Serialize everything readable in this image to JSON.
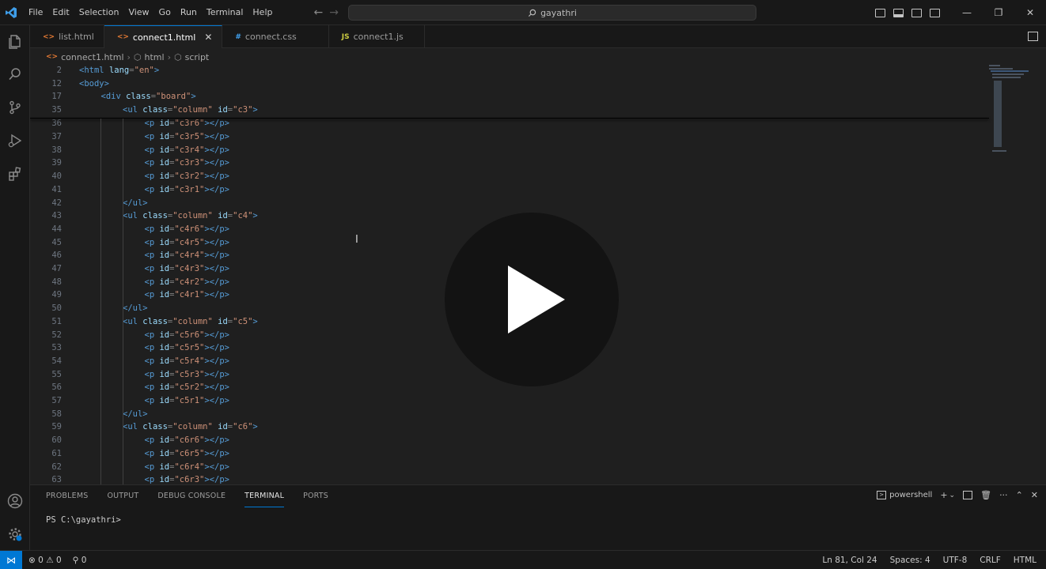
{
  "menu": [
    "File",
    "Edit",
    "Selection",
    "View",
    "Go",
    "Run",
    "Terminal",
    "Help"
  ],
  "command_center": {
    "text": "gayathri"
  },
  "tabs": [
    {
      "label": "list.html",
      "icon": "html-file-icon",
      "icon_glyph": "<>"
    },
    {
      "label": "connect1.html",
      "icon": "html-file-icon",
      "icon_glyph": "<>"
    },
    {
      "label": "connect.css",
      "icon": "css-file-icon",
      "icon_glyph": "#"
    },
    {
      "label": "connect1.js",
      "icon": "js-file-icon",
      "icon_glyph": "JS"
    }
  ],
  "breadcrumb": {
    "file": "connect1.html",
    "item1": "html",
    "item2": "script"
  },
  "code_lines": [
    {
      "n": "2",
      "indent": 0,
      "parts": [
        [
          "tag",
          "<html "
        ],
        [
          "attr",
          "lang"
        ],
        [
          "plain",
          "="
        ],
        [
          "str",
          "\"en\""
        ],
        [
          "tag",
          ">"
        ]
      ]
    },
    {
      "n": "12",
      "indent": 0,
      "parts": [
        [
          "tag",
          "<body>"
        ]
      ]
    },
    {
      "n": "17",
      "indent": 1,
      "parts": [
        [
          "tag",
          "<div "
        ],
        [
          "attr",
          "class"
        ],
        [
          "plain",
          "="
        ],
        [
          "str",
          "\"board\""
        ],
        [
          "tag",
          ">"
        ]
      ]
    },
    {
      "n": "35",
      "indent": 2,
      "parts": [
        [
          "tag",
          "<ul "
        ],
        [
          "attr",
          "class"
        ],
        [
          "plain",
          "="
        ],
        [
          "str",
          "\"column\" "
        ],
        [
          "attr",
          "id"
        ],
        [
          "plain",
          "="
        ],
        [
          "str",
          "\"c3\""
        ],
        [
          "tag",
          ">"
        ]
      ]
    },
    {
      "n": "36",
      "indent": 3,
      "parts": [
        [
          "tag",
          "<p "
        ],
        [
          "attr",
          "id"
        ],
        [
          "plain",
          "="
        ],
        [
          "str",
          "\"c3r6\""
        ],
        [
          "tag",
          "></p>"
        ]
      ]
    },
    {
      "n": "37",
      "indent": 3,
      "parts": [
        [
          "tag",
          "<p "
        ],
        [
          "attr",
          "id"
        ],
        [
          "plain",
          "="
        ],
        [
          "str",
          "\"c3r5\""
        ],
        [
          "tag",
          "></p>"
        ]
      ]
    },
    {
      "n": "38",
      "indent": 3,
      "parts": [
        [
          "tag",
          "<p "
        ],
        [
          "attr",
          "id"
        ],
        [
          "plain",
          "="
        ],
        [
          "str",
          "\"c3r4\""
        ],
        [
          "tag",
          "></p>"
        ]
      ]
    },
    {
      "n": "39",
      "indent": 3,
      "parts": [
        [
          "tag",
          "<p "
        ],
        [
          "attr",
          "id"
        ],
        [
          "plain",
          "="
        ],
        [
          "str",
          "\"c3r3\""
        ],
        [
          "tag",
          "></p>"
        ]
      ]
    },
    {
      "n": "40",
      "indent": 3,
      "parts": [
        [
          "tag",
          "<p "
        ],
        [
          "attr",
          "id"
        ],
        [
          "plain",
          "="
        ],
        [
          "str",
          "\"c3r2\""
        ],
        [
          "tag",
          "></p>"
        ]
      ]
    },
    {
      "n": "41",
      "indent": 3,
      "parts": [
        [
          "tag",
          "<p "
        ],
        [
          "attr",
          "id"
        ],
        [
          "plain",
          "="
        ],
        [
          "str",
          "\"c3r1\""
        ],
        [
          "tag",
          "></p>"
        ]
      ]
    },
    {
      "n": "42",
      "indent": 2,
      "parts": [
        [
          "tag",
          "</ul>"
        ]
      ]
    },
    {
      "n": "43",
      "indent": 2,
      "parts": [
        [
          "tag",
          "<ul "
        ],
        [
          "attr",
          "class"
        ],
        [
          "plain",
          "="
        ],
        [
          "str",
          "\"column\" "
        ],
        [
          "attr",
          "id"
        ],
        [
          "plain",
          "="
        ],
        [
          "str",
          "\"c4\""
        ],
        [
          "tag",
          ">"
        ]
      ]
    },
    {
      "n": "44",
      "indent": 3,
      "parts": [
        [
          "tag",
          "<p "
        ],
        [
          "attr",
          "id"
        ],
        [
          "plain",
          "="
        ],
        [
          "str",
          "\"c4r6\""
        ],
        [
          "tag",
          "></p>"
        ]
      ]
    },
    {
      "n": "45",
      "indent": 3,
      "parts": [
        [
          "tag",
          "<p "
        ],
        [
          "attr",
          "id"
        ],
        [
          "plain",
          "="
        ],
        [
          "str",
          "\"c4r5\""
        ],
        [
          "tag",
          "></p>"
        ]
      ]
    },
    {
      "n": "46",
      "indent": 3,
      "parts": [
        [
          "tag",
          "<p "
        ],
        [
          "attr",
          "id"
        ],
        [
          "plain",
          "="
        ],
        [
          "str",
          "\"c4r4\""
        ],
        [
          "tag",
          "></p>"
        ]
      ]
    },
    {
      "n": "47",
      "indent": 3,
      "parts": [
        [
          "tag",
          "<p "
        ],
        [
          "attr",
          "id"
        ],
        [
          "plain",
          "="
        ],
        [
          "str",
          "\"c4r3\""
        ],
        [
          "tag",
          "></p>"
        ]
      ]
    },
    {
      "n": "48",
      "indent": 3,
      "parts": [
        [
          "tag",
          "<p "
        ],
        [
          "attr",
          "id"
        ],
        [
          "plain",
          "="
        ],
        [
          "str",
          "\"c4r2\""
        ],
        [
          "tag",
          "></p>"
        ]
      ]
    },
    {
      "n": "49",
      "indent": 3,
      "parts": [
        [
          "tag",
          "<p "
        ],
        [
          "attr",
          "id"
        ],
        [
          "plain",
          "="
        ],
        [
          "str",
          "\"c4r1\""
        ],
        [
          "tag",
          "></p>"
        ]
      ]
    },
    {
      "n": "50",
      "indent": 2,
      "parts": [
        [
          "tag",
          "</ul>"
        ]
      ]
    },
    {
      "n": "51",
      "indent": 2,
      "parts": [
        [
          "tag",
          "<ul "
        ],
        [
          "attr",
          "class"
        ],
        [
          "plain",
          "="
        ],
        [
          "str",
          "\"column\" "
        ],
        [
          "attr",
          "id"
        ],
        [
          "plain",
          "="
        ],
        [
          "str",
          "\"c5\""
        ],
        [
          "tag",
          ">"
        ]
      ]
    },
    {
      "n": "52",
      "indent": 3,
      "parts": [
        [
          "tag",
          "<p "
        ],
        [
          "attr",
          "id"
        ],
        [
          "plain",
          "="
        ],
        [
          "str",
          "\"c5r6\""
        ],
        [
          "tag",
          "></p>"
        ]
      ]
    },
    {
      "n": "53",
      "indent": 3,
      "parts": [
        [
          "tag",
          "<p "
        ],
        [
          "attr",
          "id"
        ],
        [
          "plain",
          "="
        ],
        [
          "str",
          "\"c5r5\""
        ],
        [
          "tag",
          "></p>"
        ]
      ]
    },
    {
      "n": "54",
      "indent": 3,
      "parts": [
        [
          "tag",
          "<p "
        ],
        [
          "attr",
          "id"
        ],
        [
          "plain",
          "="
        ],
        [
          "str",
          "\"c5r4\""
        ],
        [
          "tag",
          "></p>"
        ]
      ]
    },
    {
      "n": "55",
      "indent": 3,
      "parts": [
        [
          "tag",
          "<p "
        ],
        [
          "attr",
          "id"
        ],
        [
          "plain",
          "="
        ],
        [
          "str",
          "\"c5r3\""
        ],
        [
          "tag",
          "></p>"
        ]
      ]
    },
    {
      "n": "56",
      "indent": 3,
      "parts": [
        [
          "tag",
          "<p "
        ],
        [
          "attr",
          "id"
        ],
        [
          "plain",
          "="
        ],
        [
          "str",
          "\"c5r2\""
        ],
        [
          "tag",
          "></p>"
        ]
      ]
    },
    {
      "n": "57",
      "indent": 3,
      "parts": [
        [
          "tag",
          "<p "
        ],
        [
          "attr",
          "id"
        ],
        [
          "plain",
          "="
        ],
        [
          "str",
          "\"c5r1\""
        ],
        [
          "tag",
          "></p>"
        ]
      ]
    },
    {
      "n": "58",
      "indent": 2,
      "parts": [
        [
          "tag",
          "</ul>"
        ]
      ]
    },
    {
      "n": "59",
      "indent": 2,
      "parts": [
        [
          "tag",
          "<ul "
        ],
        [
          "attr",
          "class"
        ],
        [
          "plain",
          "="
        ],
        [
          "str",
          "\"column\" "
        ],
        [
          "attr",
          "id"
        ],
        [
          "plain",
          "="
        ],
        [
          "str",
          "\"c6\""
        ],
        [
          "tag",
          ">"
        ]
      ]
    },
    {
      "n": "60",
      "indent": 3,
      "parts": [
        [
          "tag",
          "<p "
        ],
        [
          "attr",
          "id"
        ],
        [
          "plain",
          "="
        ],
        [
          "str",
          "\"c6r6\""
        ],
        [
          "tag",
          "></p>"
        ]
      ]
    },
    {
      "n": "61",
      "indent": 3,
      "parts": [
        [
          "tag",
          "<p "
        ],
        [
          "attr",
          "id"
        ],
        [
          "plain",
          "="
        ],
        [
          "str",
          "\"c6r5\""
        ],
        [
          "tag",
          "></p>"
        ]
      ]
    },
    {
      "n": "62",
      "indent": 3,
      "parts": [
        [
          "tag",
          "<p "
        ],
        [
          "attr",
          "id"
        ],
        [
          "plain",
          "="
        ],
        [
          "str",
          "\"c6r4\""
        ],
        [
          "tag",
          "></p>"
        ]
      ]
    },
    {
      "n": "63",
      "indent": 3,
      "parts": [
        [
          "tag",
          "<p "
        ],
        [
          "attr",
          "id"
        ],
        [
          "plain",
          "="
        ],
        [
          "str",
          "\"c6r3\""
        ],
        [
          "tag",
          "></p>"
        ]
      ]
    }
  ],
  "panel": {
    "tabs": [
      "PROBLEMS",
      "OUTPUT",
      "DEBUG CONSOLE",
      "TERMINAL",
      "PORTS"
    ],
    "active_tab": "TERMINAL",
    "shell_label": "powershell",
    "terminal_prompt": "PS C:\\gayathri>"
  },
  "status": {
    "errors": "0",
    "warnings": "0",
    "ports": "0",
    "position": "Ln 81, Col 24",
    "spaces": "Spaces: 4",
    "encoding": "UTF-8",
    "eol": "CRLF",
    "language": "HTML"
  },
  "colors": {
    "accent": "#0078d4",
    "tag": "#569cd6",
    "attribute": "#9cdcfe",
    "string": "#ce9178"
  },
  "overlay": {
    "icon": "play-icon"
  }
}
